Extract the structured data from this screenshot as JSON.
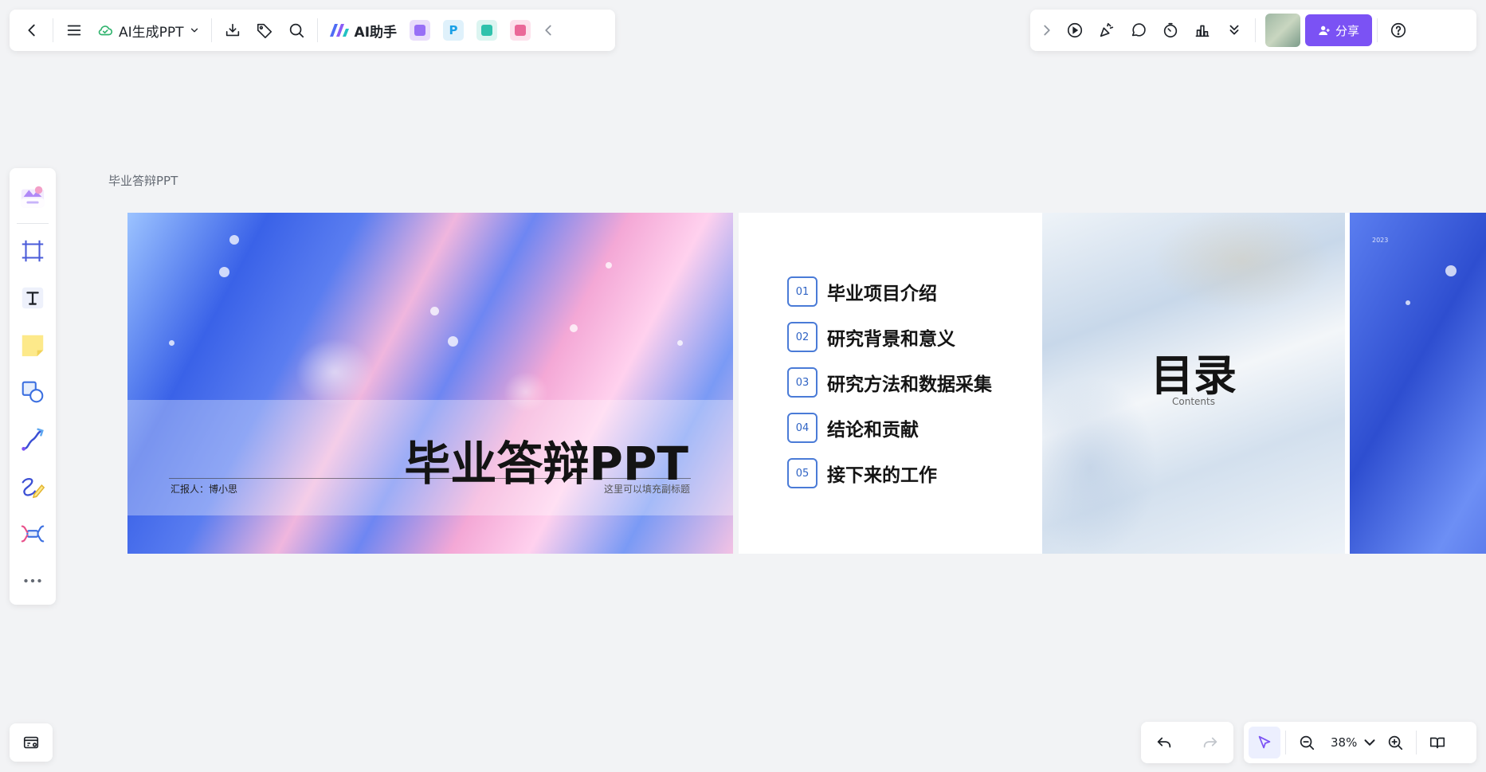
{
  "toolbar": {
    "doc_title": "AI生成PPT",
    "ai_assistant_label": "AI助手",
    "app_tiles": [
      {
        "name": "image-app",
        "glyph": "",
        "bg": "#e9ddfb",
        "fg": "#8a5cf5"
      },
      {
        "name": "ppt-app",
        "glyph": "P",
        "bg": "#dff1fb",
        "fg": "#1aa0e6"
      },
      {
        "name": "mindmap-app",
        "glyph": "",
        "bg": "#dcf5f1",
        "fg": "#11b8a0"
      },
      {
        "name": "flowchart-app",
        "glyph": "",
        "bg": "#fde1ec",
        "fg": "#e6528a"
      }
    ]
  },
  "share": {
    "label": "分享",
    "color": "#7b52f4"
  },
  "canvas": {
    "frame_label": "毕业答辩PPT"
  },
  "slide1": {
    "title": "毕业答辩PPT",
    "reporter": "汇报人：博小思",
    "subtitle": "这里可以填充副标题"
  },
  "slide2": {
    "toc": [
      {
        "num": "01",
        "text": "毕业项目介绍"
      },
      {
        "num": "02",
        "text": "研究背景和意义"
      },
      {
        "num": "03",
        "text": "研究方法和数据采集"
      },
      {
        "num": "04",
        "text": "结论和贡献"
      },
      {
        "num": "05",
        "text": "接下来的工作"
      }
    ],
    "heading": "目录",
    "subheading": "Contents"
  },
  "slide3": {
    "year": "2023"
  },
  "zoom": {
    "value": "38%"
  }
}
